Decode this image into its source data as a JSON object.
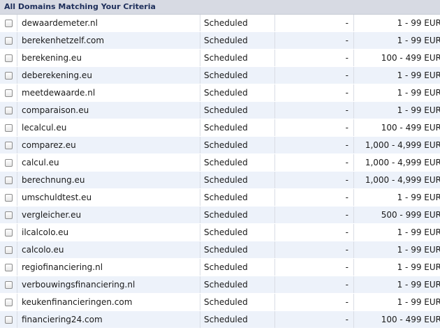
{
  "panel": {
    "title": "All Domains Matching Your Criteria"
  },
  "rows": [
    {
      "domain": "dewaardemeter.nl",
      "status": "Scheduled",
      "dash": "-",
      "price": "1 - 99 EUR"
    },
    {
      "domain": "berekenhetzelf.com",
      "status": "Scheduled",
      "dash": "-",
      "price": "1 - 99 EUR"
    },
    {
      "domain": "berekening.eu",
      "status": "Scheduled",
      "dash": "-",
      "price": "100 - 499 EUR"
    },
    {
      "domain": "deberekening.eu",
      "status": "Scheduled",
      "dash": "-",
      "price": "1 - 99 EUR"
    },
    {
      "domain": "meetdewaarde.nl",
      "status": "Scheduled",
      "dash": "-",
      "price": "1 - 99 EUR"
    },
    {
      "domain": "comparaison.eu",
      "status": "Scheduled",
      "dash": "-",
      "price": "1 - 99 EUR"
    },
    {
      "domain": "lecalcul.eu",
      "status": "Scheduled",
      "dash": "-",
      "price": "100 - 499 EUR"
    },
    {
      "domain": "comparez.eu",
      "status": "Scheduled",
      "dash": "-",
      "price": "1,000 - 4,999 EUR"
    },
    {
      "domain": "calcul.eu",
      "status": "Scheduled",
      "dash": "-",
      "price": "1,000 - 4,999 EUR"
    },
    {
      "domain": "berechnung.eu",
      "status": "Scheduled",
      "dash": "-",
      "price": "1,000 - 4,999 EUR"
    },
    {
      "domain": "umschuldtest.eu",
      "status": "Scheduled",
      "dash": "-",
      "price": "1 - 99 EUR"
    },
    {
      "domain": "vergleicher.eu",
      "status": "Scheduled",
      "dash": "-",
      "price": "500 - 999 EUR"
    },
    {
      "domain": "ilcalcolo.eu",
      "status": "Scheduled",
      "dash": "-",
      "price": "1 - 99 EUR"
    },
    {
      "domain": "calcolo.eu",
      "status": "Scheduled",
      "dash": "-",
      "price": "1 - 99 EUR"
    },
    {
      "domain": "regiofinanciering.nl",
      "status": "Scheduled",
      "dash": "-",
      "price": "1 - 99 EUR"
    },
    {
      "domain": "verbouwingsfinanciering.nl",
      "status": "Scheduled",
      "dash": "-",
      "price": "1 - 99 EUR"
    },
    {
      "domain": "keukenfinancieringen.com",
      "status": "Scheduled",
      "dash": "-",
      "price": "1 - 99 EUR"
    },
    {
      "domain": "financiering24.com",
      "status": "Scheduled",
      "dash": "-",
      "price": "100 - 499 EUR"
    }
  ]
}
